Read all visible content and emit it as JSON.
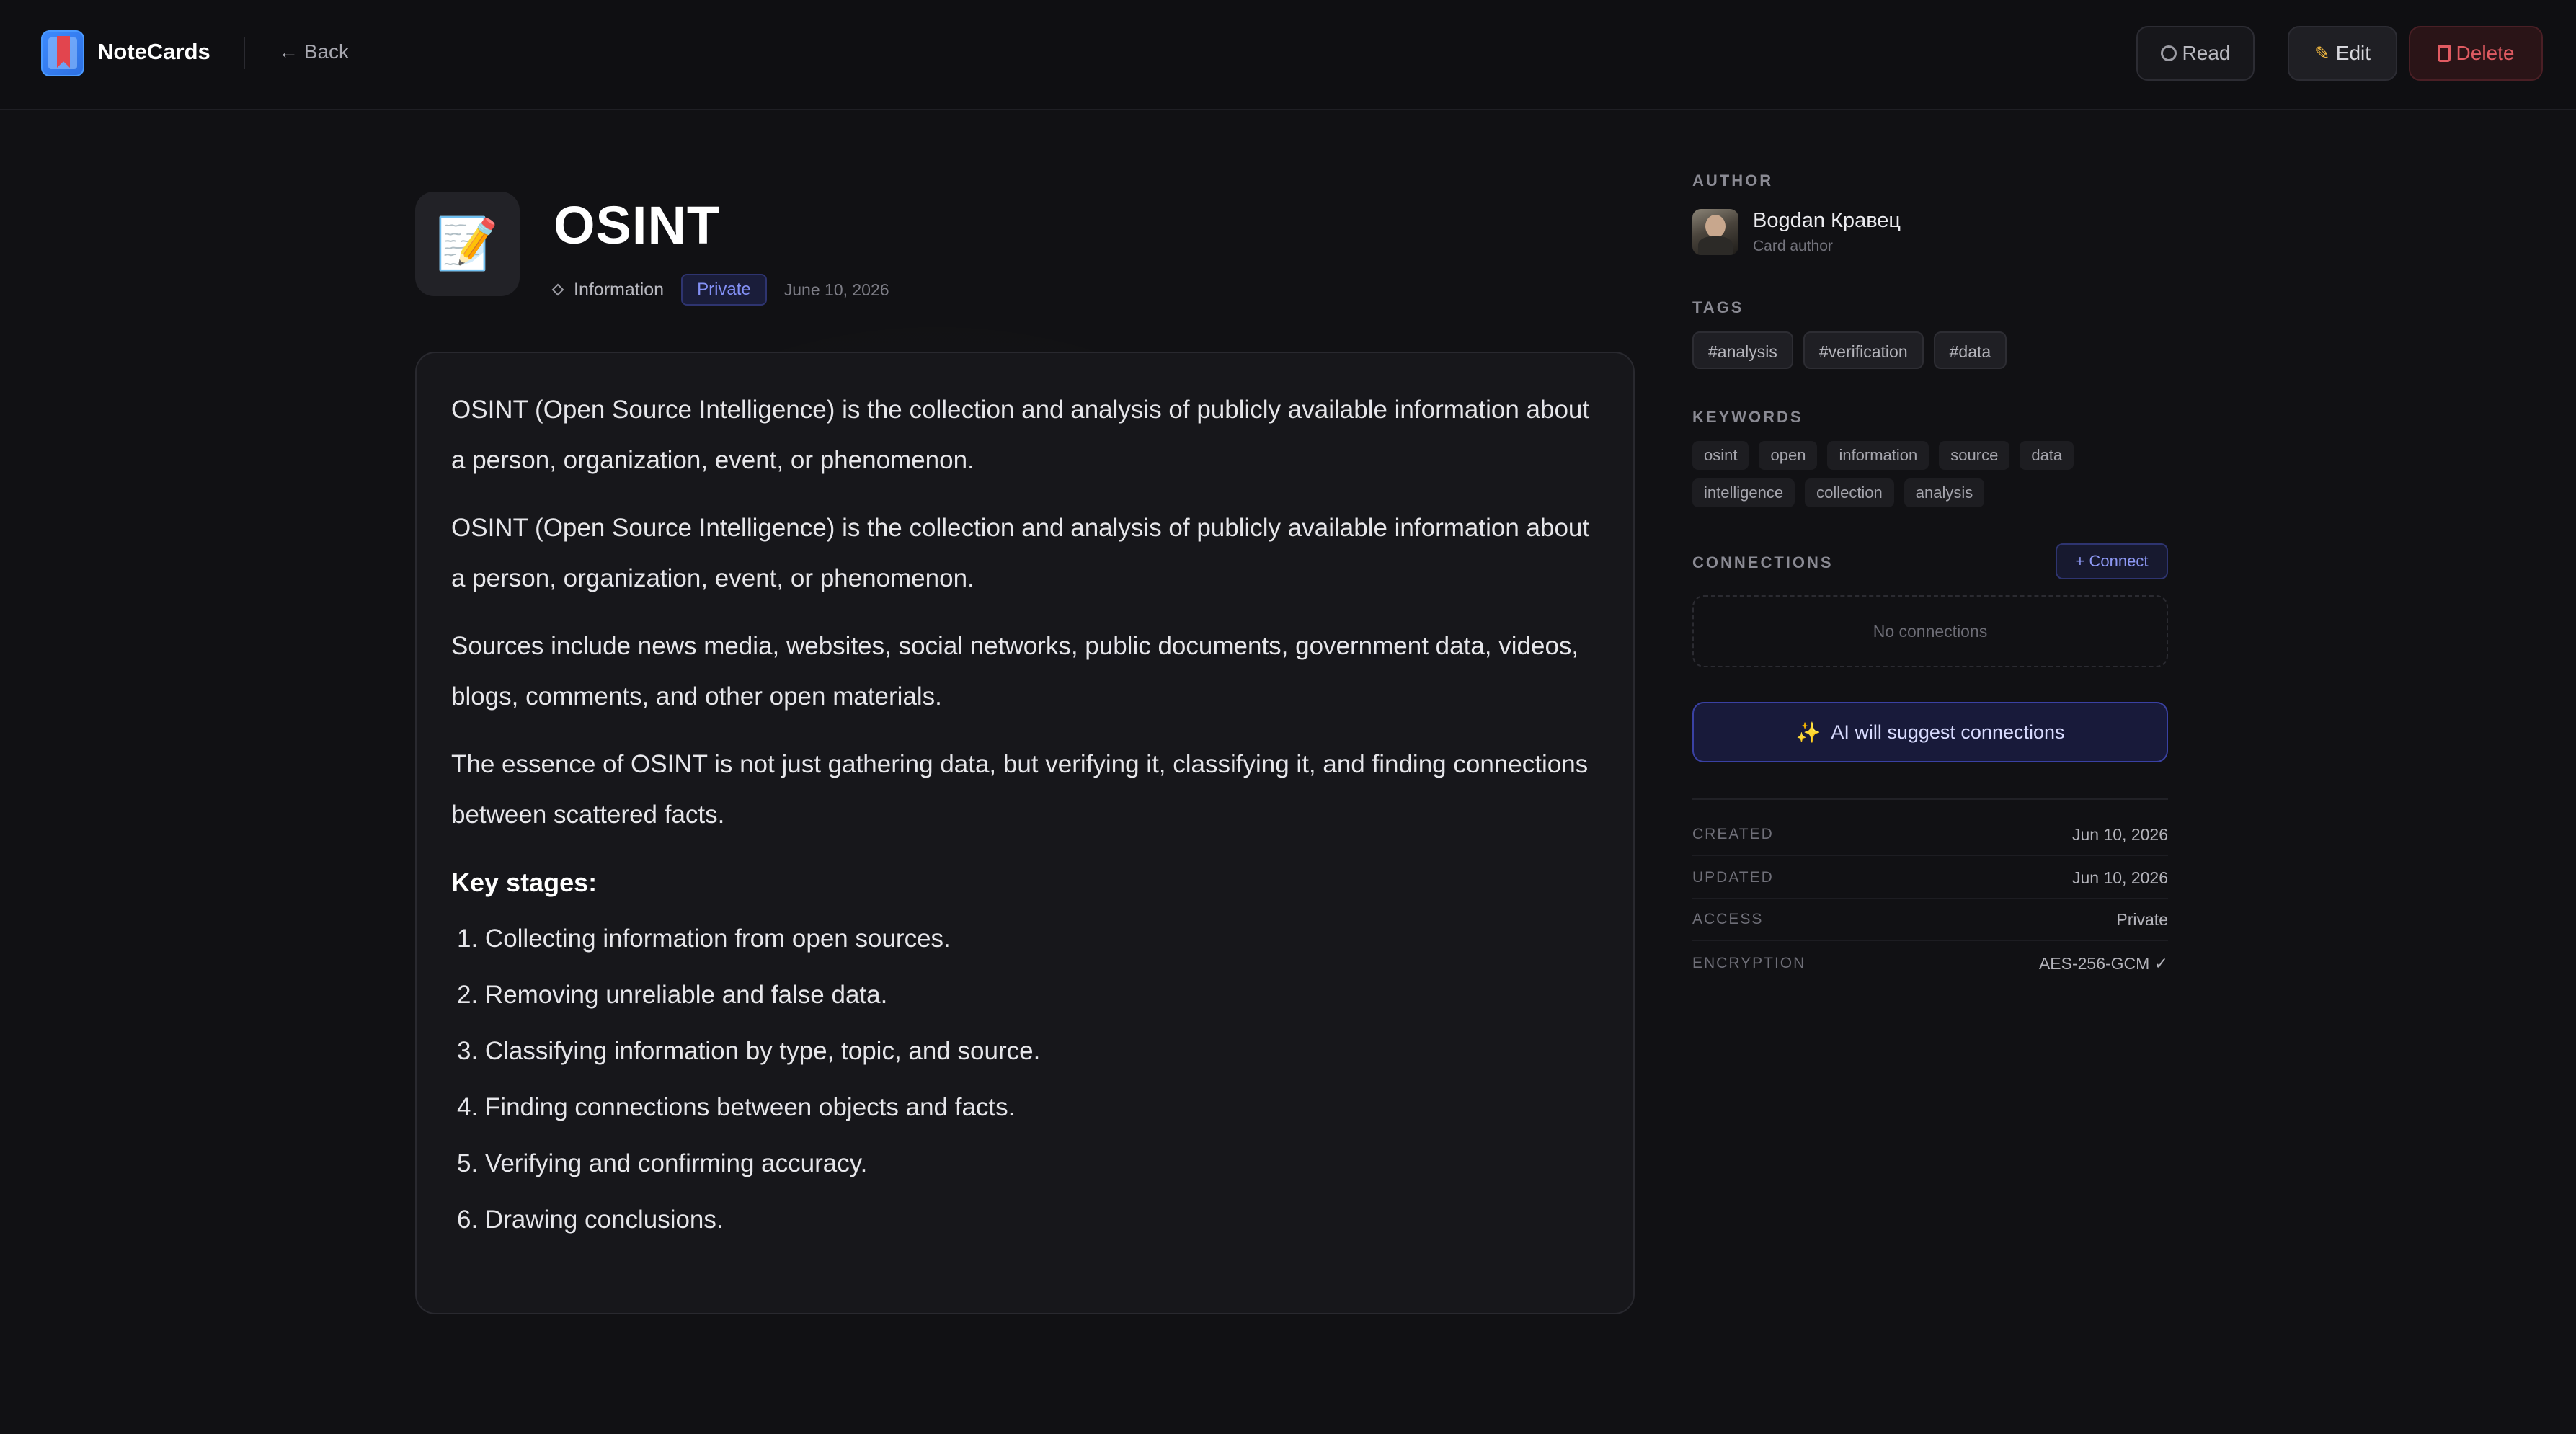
{
  "header": {
    "app_title": "NoteCards",
    "back_label": "← Back",
    "read_label": "Read",
    "edit_label": "Edit",
    "delete_label": "Delete"
  },
  "card": {
    "icon": "memo-emoji",
    "icon_glyph": "📝",
    "title": "OSINT",
    "type": "Information",
    "visibility": "Private",
    "date": "June 10, 2026",
    "paragraphs": [
      "OSINT (Open Source Intelligence) is the collection and analysis of publicly available information about a person, organization, event, or phenomenon.",
      "OSINT (Open Source Intelligence) is the collection and analysis of publicly available information about a person, organization, event, or phenomenon.",
      "Sources include news media, websites, social networks, public documents, government data, videos, blogs, comments, and other open materials.",
      "The essence of OSINT is not just gathering data, but verifying it, classifying it, and finding connections between scattered facts."
    ],
    "stages_heading": "Key stages:",
    "stages": [
      "1. Collecting information from open sources.",
      "2. Removing unreliable and false data.",
      "3. Classifying information by type, topic, and source.",
      "4. Finding connections between objects and facts.",
      "5. Verifying and confirming accuracy.",
      "6. Drawing conclusions."
    ]
  },
  "sidebar": {
    "author_label": "AUTHOR",
    "author_name": "Bogdan Кравец",
    "author_role": "Card author",
    "tags_label": "TAGS",
    "tags": [
      "#analysis",
      "#verification",
      "#data"
    ],
    "keywords_label": "KEYWORDS",
    "keywords": [
      "osint",
      "open",
      "information",
      "source",
      "data",
      "intelligence",
      "collection",
      "analysis"
    ],
    "connections_label": "CONNECTIONS",
    "connect_label": "+ Connect",
    "no_connections": "No connections",
    "ai_suggest_label": "AI will suggest connections",
    "info": [
      {
        "key": "CREATED",
        "value": "Jun 10, 2026"
      },
      {
        "key": "UPDATED",
        "value": "Jun 10, 2026"
      },
      {
        "key": "ACCESS",
        "value": "Private"
      },
      {
        "key": "ENCRYPTION",
        "value": "AES-256-GCM ✓"
      }
    ]
  },
  "colors": {
    "background": "#111114",
    "accent": "#8390f5",
    "danger": "#e05b62"
  }
}
